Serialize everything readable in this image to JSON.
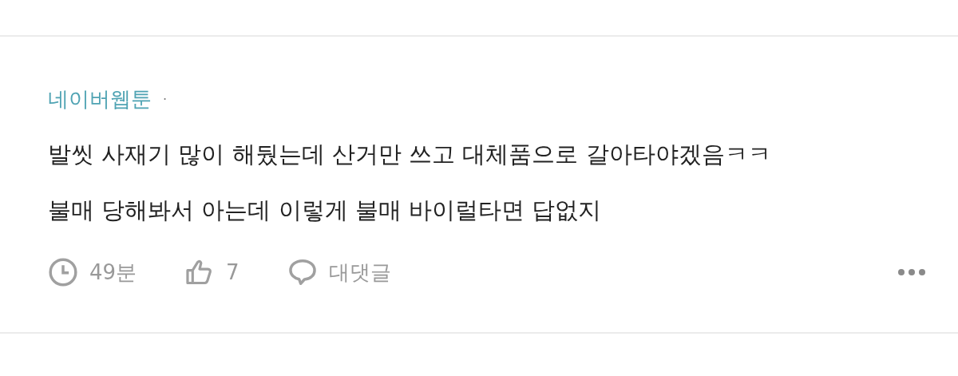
{
  "comment": {
    "author": "네이버웹툰",
    "separator": "·",
    "lines": [
      "발씻 사재기 많이 해뒀는데 산거만 쓰고 대체품으로 갈아타야겠음ㅋㅋ",
      "불매 당해봐서 아는데 이렇게 불매 바이럴타면 답없지"
    ],
    "time": "49분",
    "likes": "7",
    "reply_label": "대댓글"
  }
}
